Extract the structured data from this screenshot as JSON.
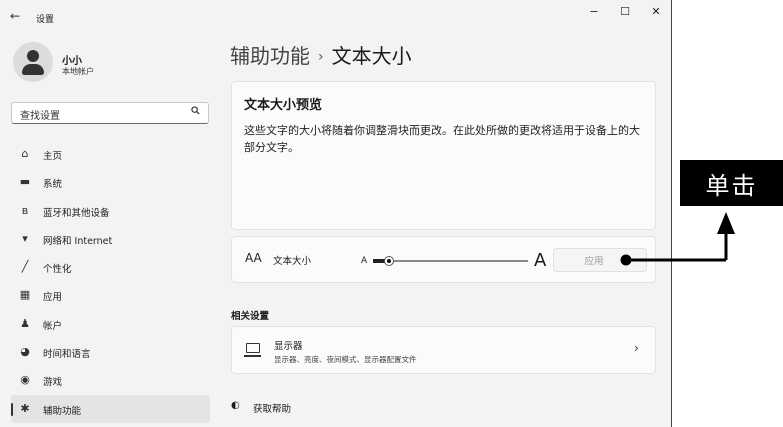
{
  "titlebar": {
    "back_glyph": "←",
    "app_title": "设置",
    "minimize": "−",
    "maximize": "☐",
    "close": "✕"
  },
  "account": {
    "name": "小小",
    "type": "本地帐户"
  },
  "search": {
    "placeholder": "查找设置",
    "icon": "search-icon"
  },
  "sidebar": {
    "items": [
      {
        "label": "主页",
        "icon": "home-icon",
        "glyph": "⌂"
      },
      {
        "label": "系统",
        "icon": "monitor-icon",
        "glyph": "▬"
      },
      {
        "label": "蓝牙和其他设备",
        "icon": "bluetooth-icon",
        "glyph": "ʙ"
      },
      {
        "label": "网络和 Internet",
        "icon": "wifi-icon",
        "glyph": "▾"
      },
      {
        "label": "个性化",
        "icon": "pen-icon",
        "glyph": "╱"
      },
      {
        "label": "应用",
        "icon": "apps-icon",
        "glyph": "▦"
      },
      {
        "label": "帐户",
        "icon": "person-icon",
        "glyph": "♟"
      },
      {
        "label": "时间和语言",
        "icon": "globe-icon",
        "glyph": "◕"
      },
      {
        "label": "游戏",
        "icon": "gamepad-icon",
        "glyph": "◉"
      },
      {
        "label": "辅助功能",
        "icon": "accessibility-icon",
        "glyph": "✱",
        "selected": true
      }
    ]
  },
  "breadcrumb": {
    "parent": "辅助功能",
    "separator": "›",
    "current": "文本大小"
  },
  "preview": {
    "heading": "文本大小预览",
    "body": "这些文字的大小将随着你调整滑块而更改。在此处所做的更改将适用于设备上的大部分文字。"
  },
  "text_size": {
    "icon_glyph": "AA",
    "label": "文本大小",
    "small_a": "A",
    "large_a": "A",
    "apply_label": "应用",
    "slider_level_fraction": 0.1
  },
  "related": {
    "heading": "相关设置",
    "display": {
      "title": "显示器",
      "subtitle": "显示器、亮度、夜间模式、显示器配置文件",
      "chevron": "›"
    }
  },
  "help": {
    "label": "获取帮助",
    "glyph": "◐"
  },
  "callout": {
    "text": "单击"
  },
  "colors": {
    "window_bg": "#f3f3f3",
    "card_bg": "#fbfbfb",
    "callout_bg": "#000000"
  }
}
